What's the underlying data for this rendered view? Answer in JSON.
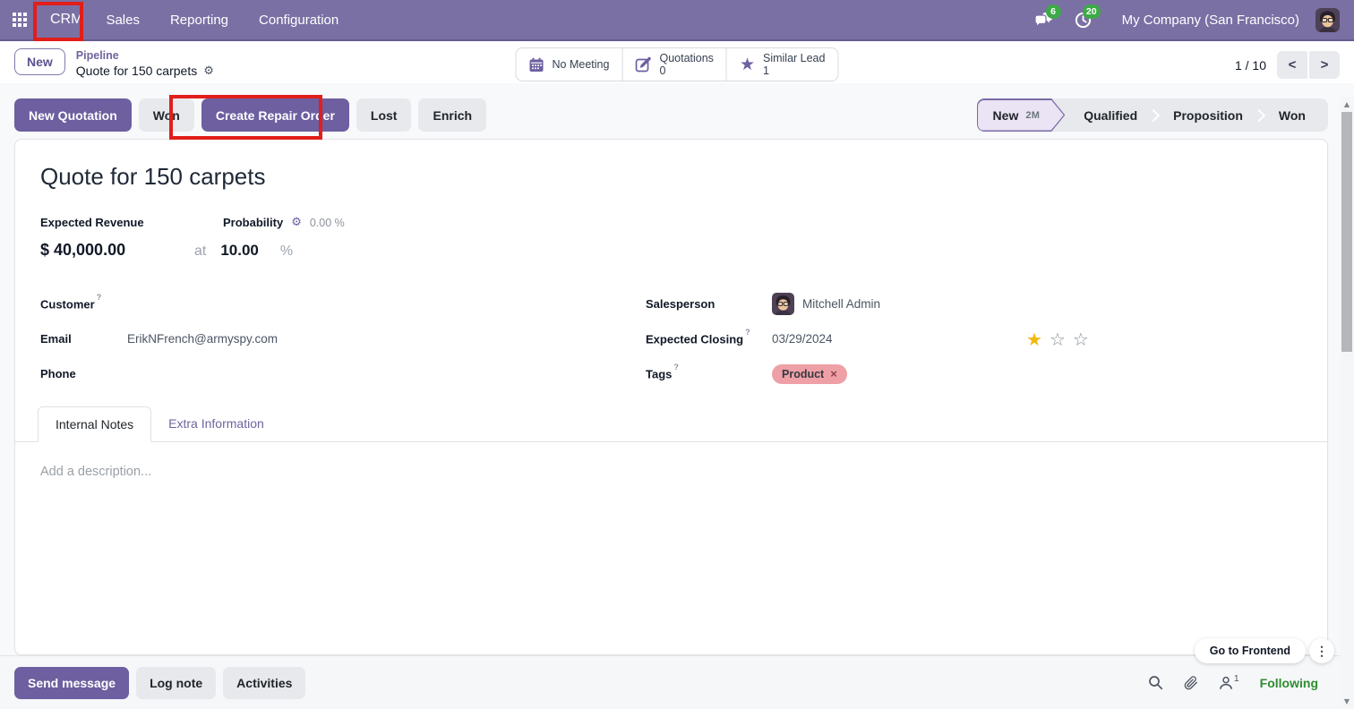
{
  "navbar": {
    "app_name": "CRM",
    "menus": [
      {
        "label": "Sales"
      },
      {
        "label": "Reporting"
      },
      {
        "label": "Configuration"
      }
    ],
    "messages_badge": "6",
    "activities_badge": "20",
    "company_name": "My Company (San Francisco)"
  },
  "control_panel": {
    "new_button_label": "New",
    "breadcrumb": {
      "parent": "Pipeline",
      "current": "Quote for 150 carpets"
    },
    "stat_buttons": [
      {
        "label": "No Meeting",
        "value": ""
      },
      {
        "label": "Quotations",
        "value": "0"
      },
      {
        "label": "Similar Lead",
        "value": "1"
      }
    ],
    "pager": {
      "value": "1 / 10"
    }
  },
  "action_bar": {
    "new_quotation": "New Quotation",
    "won": "Won",
    "create_repair_order": "Create Repair Order",
    "lost": "Lost",
    "enrich": "Enrich",
    "stages": [
      {
        "label": "New",
        "badge": "2M"
      },
      {
        "label": "Qualified",
        "badge": ""
      },
      {
        "label": "Proposition",
        "badge": ""
      },
      {
        "label": "Won",
        "badge": ""
      }
    ]
  },
  "form": {
    "title": "Quote for 150 carpets",
    "expected_revenue_label": "Expected Revenue",
    "expected_revenue_value": "$ 40,000.00",
    "probability_label": "Probability",
    "probability_auto": "0.00 %",
    "probability_at": "at",
    "probability_value": "10.00",
    "probability_suffix": "%",
    "help_marker": "?",
    "customer_label": "Customer",
    "email_label": "Email",
    "email_value": "ErikNFrench@armyspy.com",
    "phone_label": "Phone",
    "salesperson_label": "Salesperson",
    "salesperson_value": "Mitchell Admin",
    "expected_closing_label": "Expected Closing",
    "expected_closing_value": "03/29/2024",
    "tags_label": "Tags",
    "tag_value": "Product",
    "tabs": [
      {
        "label": "Internal Notes"
      },
      {
        "label": "Extra Information"
      }
    ],
    "description_placeholder": "Add a description..."
  },
  "floating": {
    "go_to_frontend": "Go to Frontend"
  },
  "chatter": {
    "send_message": "Send message",
    "log_note": "Log note",
    "activities": "Activities",
    "followers_count": "1",
    "following": "Following"
  },
  "icons": {
    "gear": "⚙",
    "close": "×",
    "kebab": "⋮",
    "star_filled": "★",
    "star_empty": "☆",
    "chevron_left": "<",
    "chevron_right": ">",
    "scroll_up": "▲",
    "scroll_down": "▼"
  },
  "colors": {
    "navbar_purple": "#7a70a4",
    "primary_purple": "#6d5fa0",
    "annotation_red": "#e11e19",
    "badge_green": "#3caa46",
    "following_green": "#2f8c2f",
    "star_gold": "#f0b90f",
    "tag_pink": "#eea0a6",
    "stage_active_bg": "#eae4f4"
  }
}
